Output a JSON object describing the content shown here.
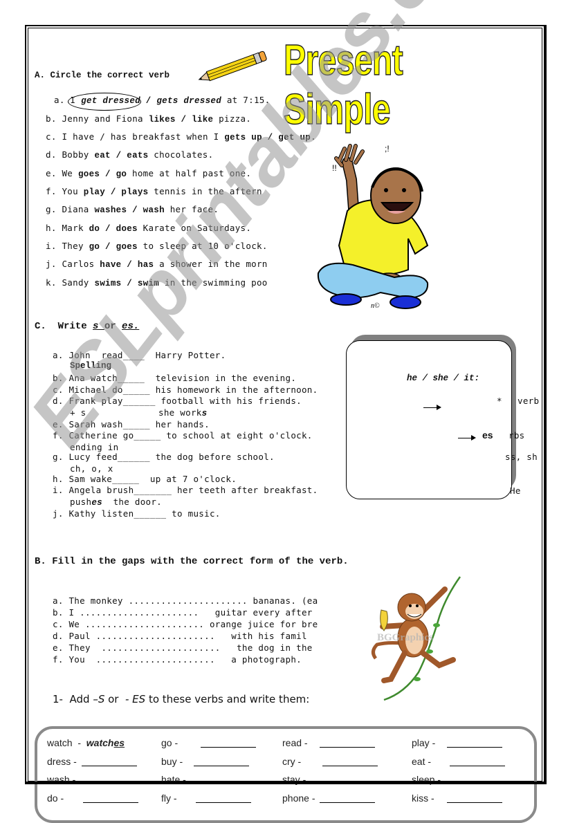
{
  "title": "Present Simple",
  "watermark": "ESLprintables.com",
  "section_a": {
    "heading": "A. Circle the correct verb",
    "items": [
      {
        "letter": "a.",
        "pre": "I ",
        "opt1": "get dressed",
        "sep": " / ",
        "opt2": "gets dressed",
        "post": " at 7:15."
      },
      {
        "letter": "b.",
        "pre": "Jenny and Fiona ",
        "opt1": "likes",
        "sep": " / ",
        "opt2": "like",
        "post": " pizza."
      },
      {
        "letter": "c.",
        "pre": "I have / has breakfast when I ",
        "opt1": "gets up",
        "sep": " / ",
        "opt2": "get up",
        "post": "."
      },
      {
        "letter": "d.",
        "pre": "Bobby ",
        "opt1": "eat",
        "sep": " / ",
        "opt2": "eats",
        "post": " chocolates."
      },
      {
        "letter": "e.",
        "pre": "We ",
        "opt1": "goes",
        "sep": " / ",
        "opt2": "go",
        "post": " home at half past one."
      },
      {
        "letter": "f.",
        "pre": "You ",
        "opt1": "play",
        "sep": " / ",
        "opt2": "plays",
        "post": " tennis in the aftern"
      },
      {
        "letter": "g.",
        "pre": "Diana ",
        "opt1": "washes",
        "sep": " / ",
        "opt2": "wash",
        "post": " her face."
      },
      {
        "letter": "h.",
        "pre": "Mark ",
        "opt1": "do",
        "sep": " / ",
        "opt2": "does",
        "post": " Karate on Saturdays."
      },
      {
        "letter": "i.",
        "pre": "They ",
        "opt1": "go",
        "sep": " / ",
        "opt2": "goes",
        "post": " to sleep at 10 o'clock."
      },
      {
        "letter": "j.",
        "pre": "Carlos ",
        "opt1": "have",
        "sep": " / ",
        "opt2": "has",
        "post": " a shower in the morn"
      },
      {
        "letter": "k.",
        "pre": "Sandy ",
        "opt1": "swims",
        "sep": " / ",
        "opt2": "swim",
        "post": " in the swimming poo"
      }
    ]
  },
  "section_c": {
    "heading_prefix": "C.  Write ",
    "heading_s": "s ",
    "heading_or": "or ",
    "heading_es": "es.",
    "items": [
      {
        "letter": "a.",
        "text": "John  read____  Harry Potter."
      },
      {
        "letter": "b.",
        "text": "Ana watch_____  television in the evening."
      },
      {
        "letter": "c.",
        "text": "Michael do_____ his homework in the afternoon."
      },
      {
        "letter": "d.",
        "text": "Frank play______ football with his friends."
      },
      {
        "letter": "e.",
        "text": "Sarah wash_____ her hands."
      },
      {
        "letter": "f.",
        "text": "Catherine go_____ to school at eight o'clock."
      },
      {
        "letter": "g.",
        "text": "Lucy feed______ the dog before school."
      },
      {
        "letter": "h.",
        "text": "Sam wake_____  up at 7 o'clock."
      },
      {
        "letter": "i.",
        "text": "Angela brush_______ her teeth after breakfast."
      },
      {
        "letter": "j.",
        "text": "Kathy listen______ to music."
      }
    ],
    "fragments": {
      "spelling": "Spelling",
      "plus_s": "+ s",
      "she_works_pre": "she work",
      "she_works_s": "s",
      "ending_in": "ending in",
      "endings": "ch, o, x",
      "pushes_pre": "push",
      "pushes_es": "es",
      "pushes_post": "  the door."
    },
    "rule_box": {
      "subject": "he / she / it:",
      "star": "*",
      "es": "es",
      "right_verb": "verb",
      "right_rbs": "rbs",
      "right_ssh": "ss, sh",
      "right_he": "He"
    }
  },
  "section_b": {
    "heading": "B.  Fill in the gaps with the correct form of the verb.",
    "items": [
      {
        "letter": "a.",
        "text": "The monkey ...................... bananas. (ea"
      },
      {
        "letter": "b.",
        "text": "I ......................   guitar every after"
      },
      {
        "letter": "c.",
        "text": "We ...................... orange juice for bre"
      },
      {
        "letter": "d.",
        "text": "Paul ......................   with his famil"
      },
      {
        "letter": "e.",
        "text": "They  ......................   the dog in the"
      },
      {
        "letter": "f.",
        "text": "You  ......................   a photograph."
      }
    ]
  },
  "add_s": {
    "prefix": "1-  Add ",
    "s": "–S",
    "or": " or ",
    "es": " - ES",
    "suffix": " to these verbs and write them:",
    "example_base": "watch  -",
    "example_answer_pre": "watch",
    "example_answer_es": "es",
    "rows": [
      [
        "watch",
        "go -",
        "read -",
        "play -"
      ],
      [
        "dress -",
        "buy -",
        "cry -",
        "eat -"
      ],
      [
        "wash -",
        "hate -",
        "stay -",
        "sleep -"
      ],
      [
        "do -",
        "fly -",
        "phone -",
        "kiss -"
      ]
    ]
  },
  "illustrations": {
    "pencil": "pencil-illustration",
    "boy": "boy-waving-illustration",
    "monkey": "monkey-with-banana-illustration",
    "monkey_watermark": "BGGraphics"
  },
  "colors": {
    "title_yellow": "#ffff00",
    "shirt_yellow": "#f4f02a",
    "jeans_blue": "#8ecdf0",
    "shoes_blue": "#1a2fd6",
    "skin": "#a8744a",
    "watermark_gray": "#969696"
  }
}
